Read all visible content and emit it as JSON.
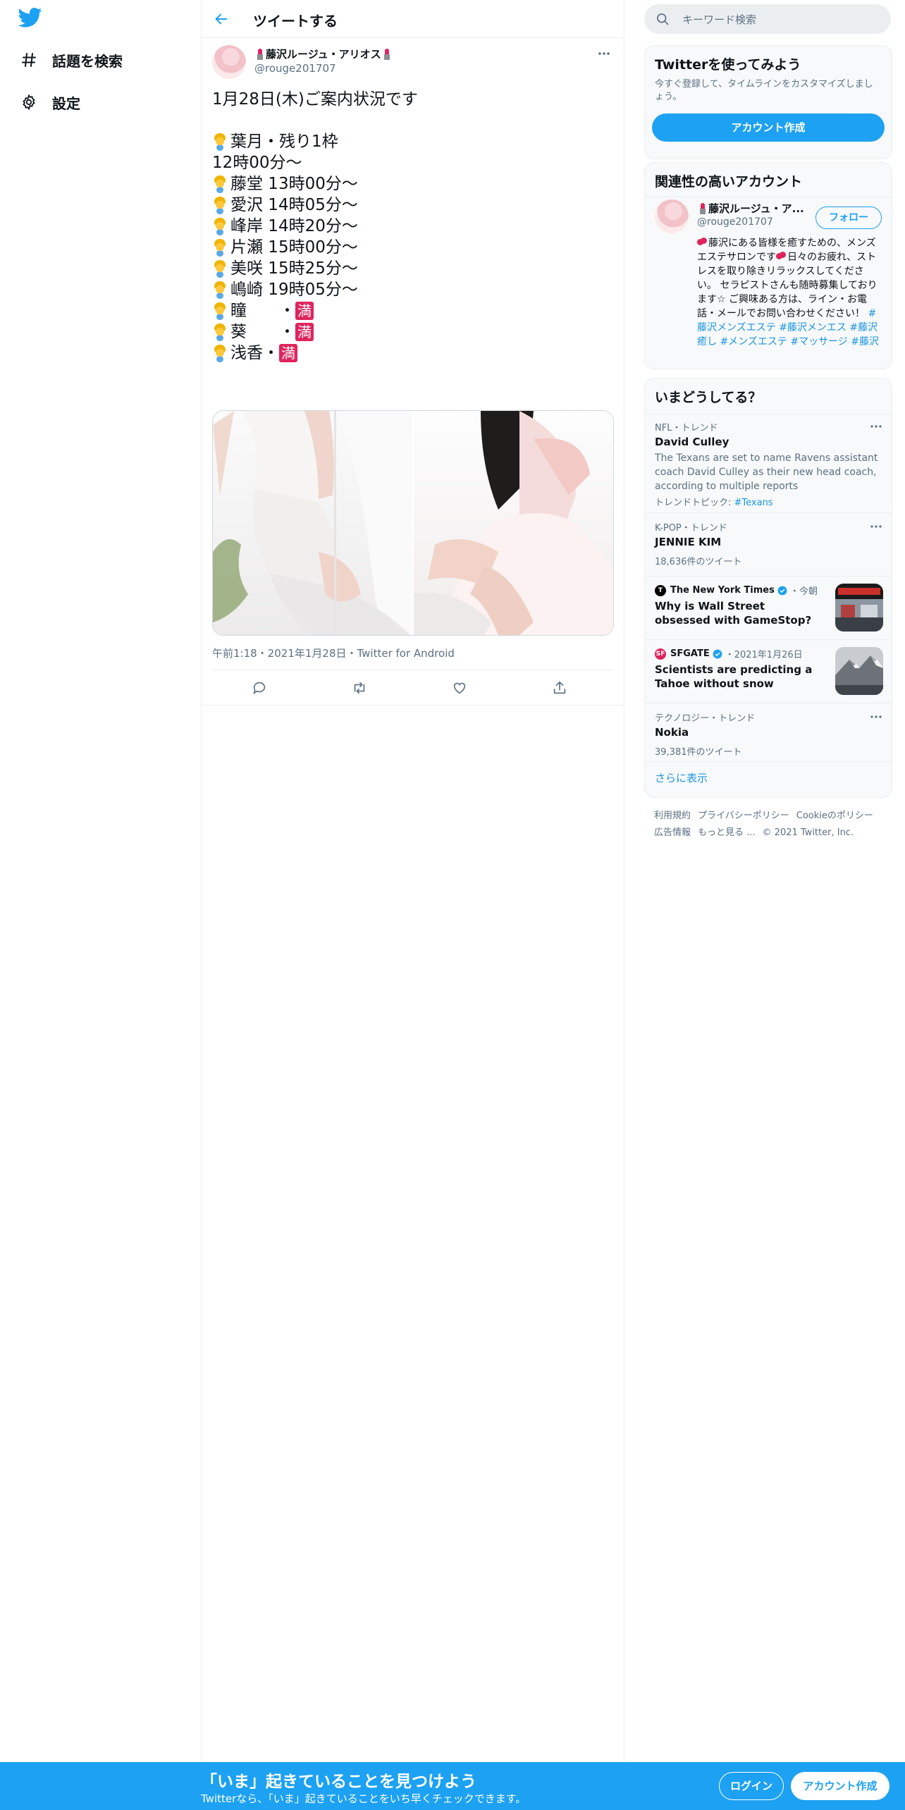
{
  "nav": {
    "items": [
      {
        "label": "話題を検索",
        "icon": "hashtag-icon"
      },
      {
        "label": "設定",
        "icon": "gear-icon"
      }
    ]
  },
  "header": {
    "title": "ツイートする"
  },
  "tweet": {
    "display_name": "藤沢ルージュ・アリオス",
    "handle": "@rouge201707",
    "lines": [
      "1月28日(木)ご案内状況です",
      "",
      "葉月・残り1枠",
      "12時00分～",
      "藤堂 13時00分～",
      "愛沢 14時05分～",
      "峰岸 14時20分～",
      "片瀬 15時00分～",
      "美咲 15時25分～",
      "嶋崎 19時05分～",
      "瞳　　・",
      "葵　　・",
      "浅香・"
    ],
    "full_label": "満",
    "meta": "午前1:18・2021年1月28日・Twitter for Android"
  },
  "search": {
    "placeholder": "キーワード検索"
  },
  "signup_card": {
    "title": "Twitterを使ってみよう",
    "desc": "今すぐ登録して、タイムラインをカスタマイズしましょう。",
    "button": "アカウント作成"
  },
  "related": {
    "title": "関連性の高いアカウント",
    "name": "藤沢ルージュ・ア...",
    "handle": "@rouge201707",
    "follow": "フォロー",
    "bio_1": "藤沢にある皆様を癒すための、メンズエステサロンです",
    "bio_2": "日々のお疲れ、ストレスを取り除きリラックスしてください。 セラピストさんも随時募集しております☆ ご興味ある方は、ライン・お電話・メールでお問い合わせください！ ",
    "tags": [
      "#藤沢メンズエステ",
      "#藤沢メンエス",
      "#藤沢癒し",
      "#メンズエステ",
      "#マッサージ",
      "#藤沢"
    ]
  },
  "trends": {
    "title": "いまどうしてる？",
    "items": [
      {
        "meta": "NFL・トレンド",
        "name": "David Culley",
        "desc": "The Texans are set to name Ravens assistant coach David Culley as their new head coach, according to multiple reports",
        "topic_prefix": "トレンドトピック: ",
        "topic": "#Texans"
      },
      {
        "meta": "K-POP・トレンド",
        "name": "JENNIE KIM",
        "count": "18,636件のツイート"
      },
      {
        "source": "The New York Times",
        "time": "・今朝",
        "headline": "Why is Wall Street obsessed with GameStop?"
      },
      {
        "source": "SFGATE",
        "time": "・2021年1月26日",
        "headline": "Scientists are predicting a Tahoe without snow"
      },
      {
        "meta": "テクノロジー・トレンド",
        "name": "Nokia",
        "count": "39,381件のツイート"
      }
    ],
    "show_more": "さらに表示"
  },
  "footer": {
    "links": [
      "利用規約",
      "プライバシーポリシー",
      "Cookieのポリシー",
      "広告情報",
      "もっと見る ...",
      "© 2021 Twitter, Inc."
    ]
  },
  "bottom": {
    "title": "「いま」起きていることを見つけよう",
    "subtitle": "Twitterなら、「いま」起きていることをいち早くチェックできます。",
    "login": "ログイン",
    "signup": "アカウント作成"
  },
  "colors": {
    "accent": "#1da1f2",
    "muted": "#5b7083",
    "link": "#1b95e0",
    "full_badge": "#e0245e"
  }
}
